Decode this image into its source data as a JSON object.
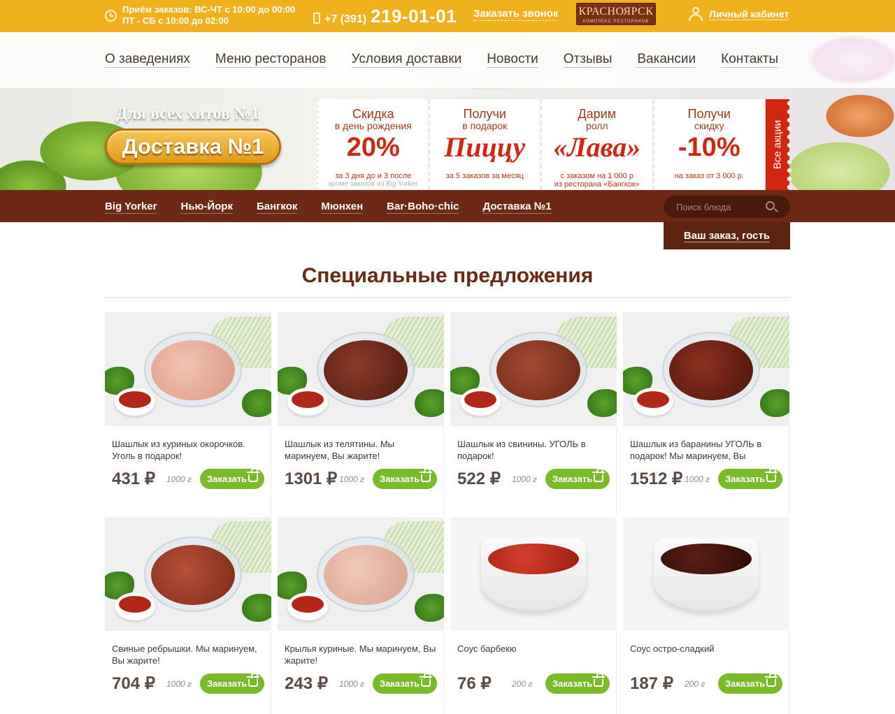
{
  "topbar": {
    "hours_line1": "Приём заказов: ВС-ЧТ с 10:00 до 00:00",
    "hours_line2": "ПТ - СБ с 10:00 до 02:00",
    "phone_prefix": "+7 (391)",
    "phone_main": "219-01-01",
    "callback_label": "Заказать звонок",
    "logo_main": "КРАСНОЯРСК",
    "logo_sub": "КОМПЛЕКС РЕСТОРАНОВ",
    "cabinet_label": "Личный кабинет"
  },
  "mainnav": [
    "О заведениях",
    "Меню ресторанов",
    "Условия доставки",
    "Новости",
    "Отзывы",
    "Вакансии",
    "Контакты"
  ],
  "hero": {
    "tagline": "Для всех хитов №1",
    "button_label": "Доставка №1",
    "all_promos_label": "Все акции",
    "offers": [
      {
        "t1": "Скидка",
        "t2": "в день рождения",
        "big": "20%",
        "note": "за 3 дня до и 3 после",
        "note2": "кроме заказов из Big Yorker",
        "script": false
      },
      {
        "t1": "Получи",
        "t2": "в подарок",
        "big": "Пиццу",
        "note": "за 5 заказов за месяц",
        "note2": "",
        "script": true
      },
      {
        "t1": "Дарим",
        "t2": "ролл",
        "big": "«Лава»",
        "note": "с заказом на 1 000 р",
        "note2": "из ресторана «Бангкок»",
        "script": true
      },
      {
        "t1": "Получи",
        "t2": "скидку",
        "big": "-10%",
        "note": "на заказ от 3 000 р.",
        "note2": "",
        "script": false
      }
    ]
  },
  "restnav": [
    "Big Yorker",
    "Нью-Йорк",
    "Бангкок",
    "Мюнхен",
    "Bar·Boho·chic",
    "Доставка №1"
  ],
  "search": {
    "placeholder": "Поиск блюда"
  },
  "order_box": "Ваш заказ, гость",
  "section_title": "Специальные предложения",
  "order_button_label": "Заказать",
  "products": [
    {
      "name": "Шашлык из куриных окорочков. Уголь в подарок!",
      "price": "431 ₽",
      "weight": "1000 г",
      "kind": "chicken"
    },
    {
      "name": "Шашлык из телятины. Мы маринуем, Вы жарите!",
      "price": "1301 ₽",
      "weight": "1000 г",
      "kind": "veal"
    },
    {
      "name": "Шашлык из свинины. УГОЛЬ в подарок!",
      "price": "522 ₽",
      "weight": "1000 г",
      "kind": "pork"
    },
    {
      "name": "Шашлык из баранины УГОЛЬ в подарок! Мы маринуем, Вы",
      "price": "1512 ₽",
      "weight": "1000 г",
      "kind": "lamb"
    },
    {
      "name": "Свиные ребрышки. Мы маринуем, Вы жарите!",
      "price": "704 ₽",
      "weight": "1000 г",
      "kind": "ribs"
    },
    {
      "name": "Крылья куриные. Мы маринуем, Вы жарите!",
      "price": "243 ₽",
      "weight": "1000 г",
      "kind": "wings"
    },
    {
      "name": "Соус барбекю",
      "price": "76 ₽",
      "weight": "200 г",
      "kind": "sauce-red"
    },
    {
      "name": "Соус остро-сладкий",
      "price": "187 ₽",
      "weight": "200 г",
      "kind": "sauce-brown"
    }
  ],
  "colors": {
    "accent": "#f0b21c",
    "brown": "#6e2916",
    "green": "#7ab92a",
    "red": "#d1260f"
  }
}
